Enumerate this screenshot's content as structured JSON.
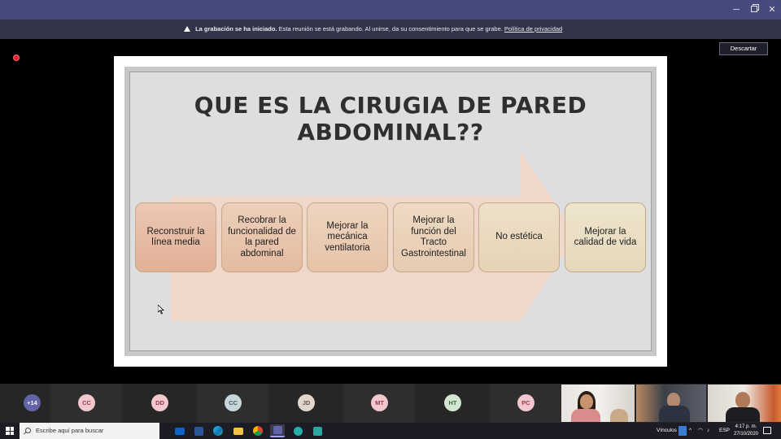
{
  "window": {
    "minimize_glyph": "─",
    "close_glyph": "✕"
  },
  "banner": {
    "bold_text": "La grabación se ha iniciado.",
    "text": "Esta reunión se está grabando. Al unirse, da su consentimiento para que se grabe.",
    "link": "Política de privacidad",
    "discard_label": "Descartar"
  },
  "slide": {
    "title_line1": "QUE ES LA CIRUGIA DE PARED",
    "title_line2": "ABDOMINAL??",
    "steps": [
      "Reconstruir la línea media",
      "Recobrar la funcionalidad de la pared abdominal",
      "Mejorar la mecánica ventilatoria",
      "Mejorar la función del Tracto Gastrointestinal",
      "No estética",
      "Mejorar la calidad de vida"
    ]
  },
  "participants": {
    "more": "+14",
    "avatars": [
      {
        "initials": "CC",
        "bg": "#f3c7cf",
        "fg": "#9b3b4b"
      },
      {
        "initials": "DD",
        "bg": "#f3c7cf",
        "fg": "#9b3b4b"
      },
      {
        "initials": "CC",
        "bg": "#c8d7dc",
        "fg": "#3e5b66"
      },
      {
        "initials": "JD",
        "bg": "#e2d6cc",
        "fg": "#6b5646"
      },
      {
        "initials": "MT",
        "bg": "#f3c7cf",
        "fg": "#9b3b4b"
      },
      {
        "initials": "HT",
        "bg": "#d2e6d2",
        "fg": "#3d6b3d"
      },
      {
        "initials": "PC",
        "bg": "#f3c7cf",
        "fg": "#9b3b4b"
      }
    ]
  },
  "taskbar": {
    "search_placeholder": "Escribe aquí para buscar",
    "links_label": "Vínculos",
    "language": "ESP",
    "time": "4:17 p. m.",
    "date": "27/10/2020"
  },
  "colors": {
    "accent": "#6264a7",
    "banner_bg": "#33344a",
    "titlebar_bg": "#474a7c"
  }
}
